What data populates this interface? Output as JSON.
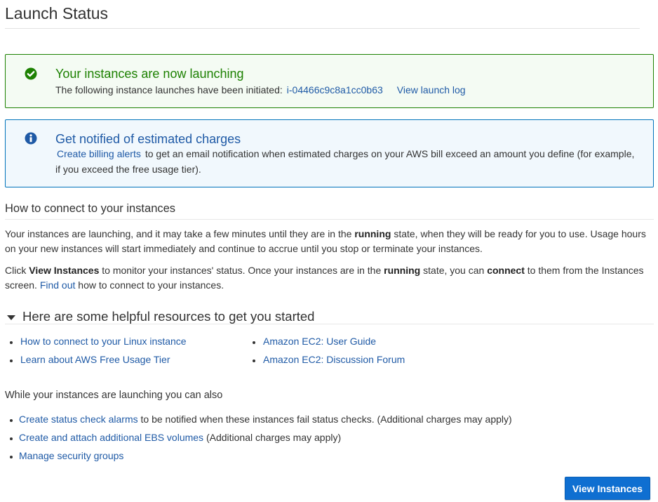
{
  "page": {
    "title": "Launch Status"
  },
  "success_alert": {
    "heading": "Your instances are now launching",
    "text": "The following instance launches have been initiated:",
    "instance_id": "i-04466c9c8a1cc0b63",
    "log_link": "View launch log"
  },
  "info_alert": {
    "heading": "Get notified of estimated charges",
    "billing_link": "Create billing alerts",
    "text_line1": "to get an email notification when estimated charges on your AWS bill exceed an amount you define (for example,",
    "text_line2": "if you exceed the free usage tier)."
  },
  "connect": {
    "title": "How to connect to your instances",
    "para1": {
      "a": "Your instances are launching, and it may take a few minutes until they are in the",
      "b_running": "running",
      "c": "state, when they will be ready for you to use. Usage hours",
      "d": "on your new instances will start immediately and continue to accrue until you stop or terminate your instances."
    },
    "para2": {
      "a": "Click",
      "b_view": "View Instances",
      "c": "to monitor your instances' status. Once your instances are in the",
      "d_running": "running",
      "e": "state, you can",
      "f_connect": "connect",
      "g": "to them from the Instances",
      "h": "screen.",
      "find_out": "Find out",
      "i": "how to connect to your instances."
    }
  },
  "resources": {
    "title": "Here are some helpful resources to get you started",
    "col1": [
      "How to connect to your Linux instance",
      "Learn about AWS Free Usage Tier"
    ],
    "col2": [
      "Amazon EC2: User Guide",
      "Amazon EC2: Discussion Forum"
    ]
  },
  "also": {
    "title": "While your instances are launching you can also",
    "item1_link": "Create status check alarms",
    "item1_text": "to be notified when these instances fail status checks. (Additional charges may apply)",
    "item2_link": "Create and attach additional EBS volumes",
    "item2_text": "(Additional charges may apply)",
    "item3_link": "Manage security groups"
  },
  "actions": {
    "view_instances": "View Instances"
  },
  "colors": {
    "success": "#1d8102",
    "info": "#0073bb",
    "link": "#1f5aa6",
    "primary": "#0f6fd1"
  },
  "icons": {
    "success": "check-circle-icon",
    "info": "info-circle-icon",
    "expand": "caret-down-icon"
  }
}
